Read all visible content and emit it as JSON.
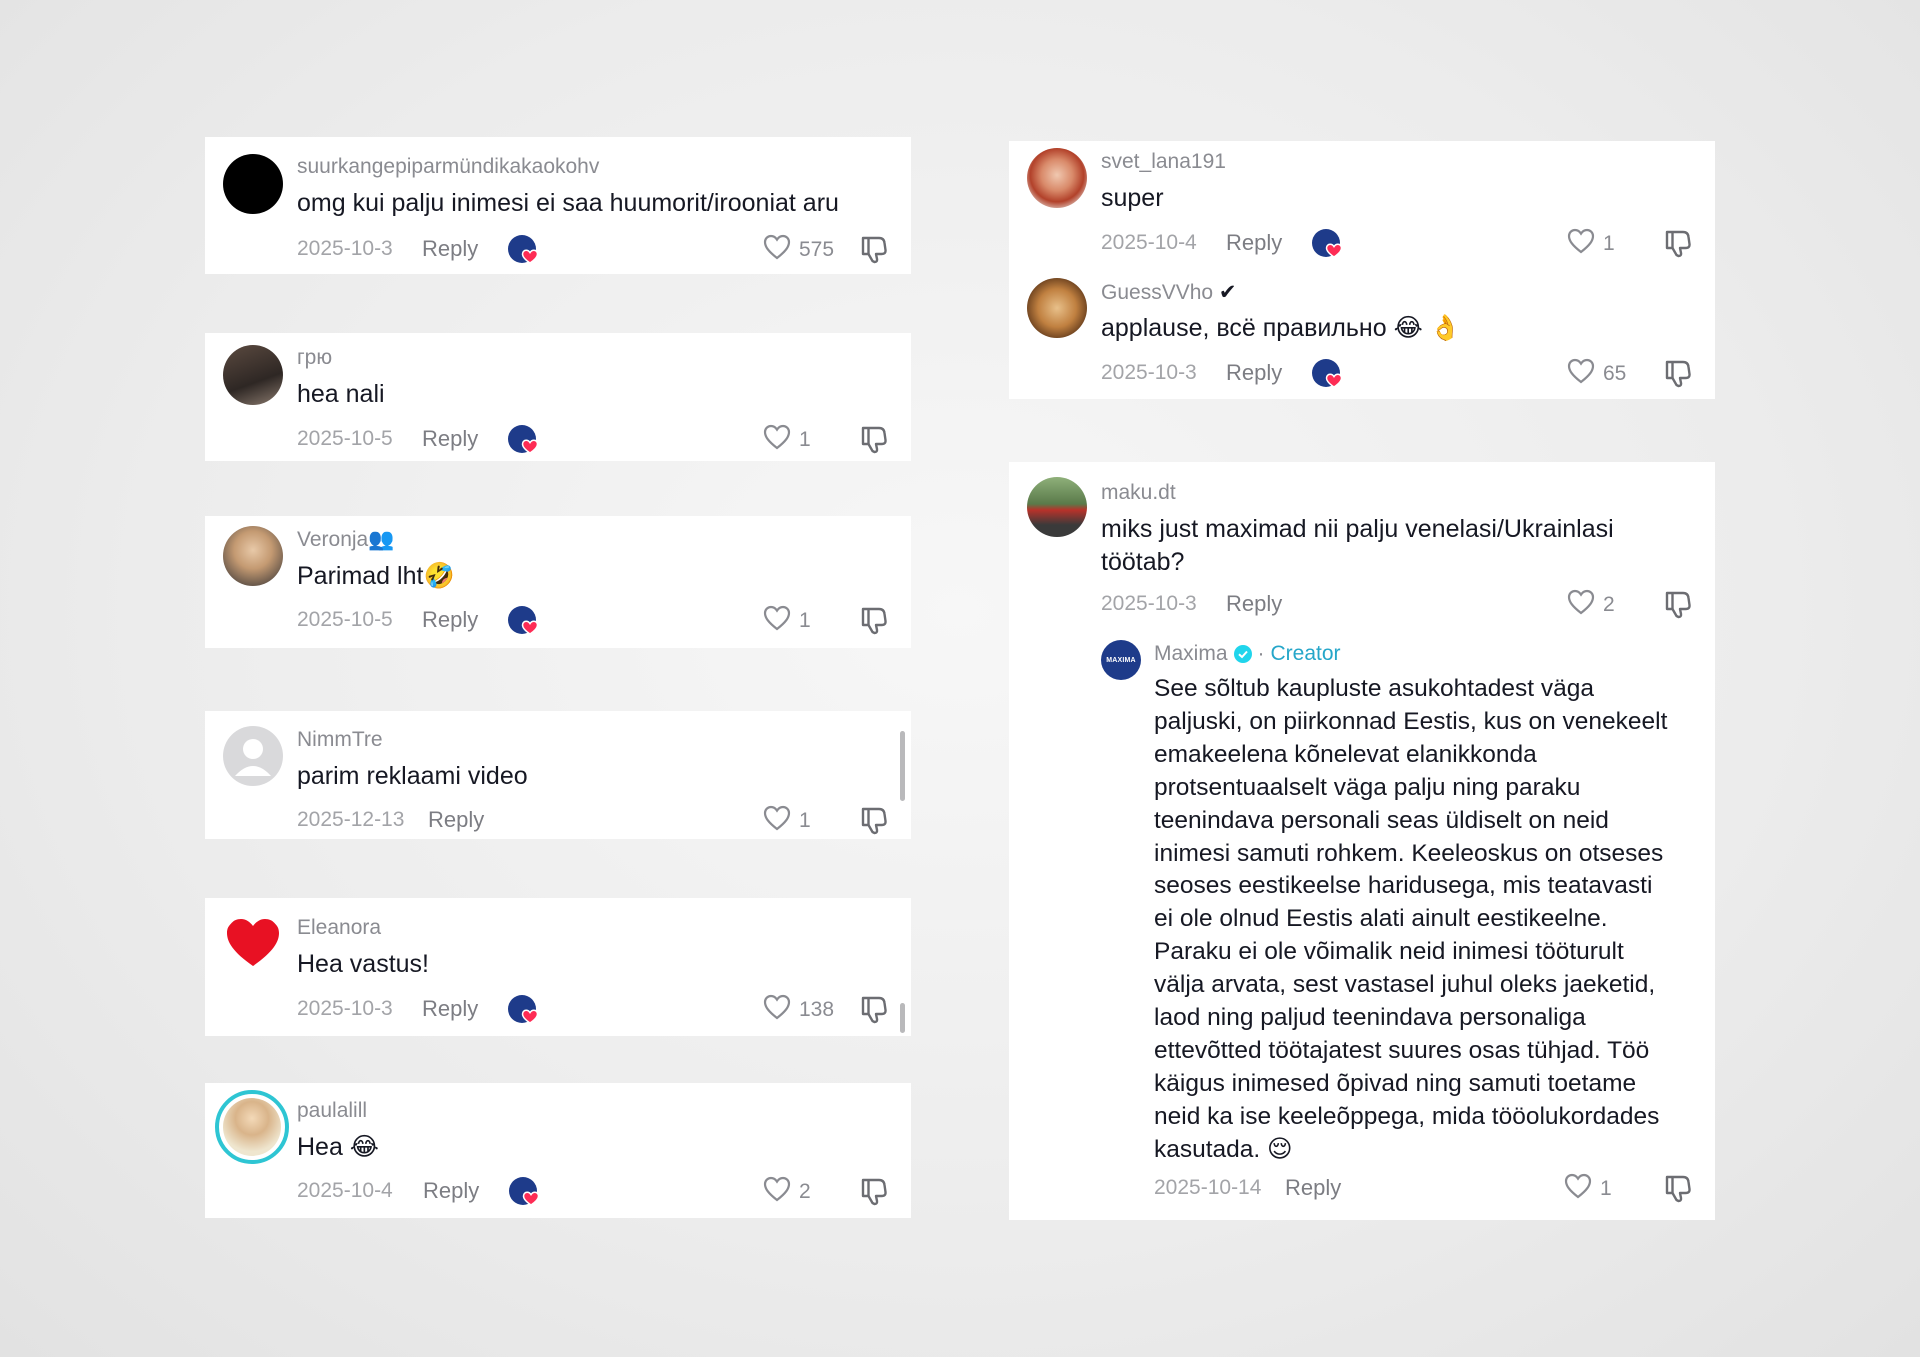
{
  "left_comments": [
    {
      "username": "suurkangepiparmündikakaokohv",
      "text": "omg kui palju inimesi ei saa huumorit/irooniat aru",
      "date": "2025-10-3",
      "reply": "Reply",
      "likes": "575",
      "avatar_icon": "black-circle-avatar-icon",
      "creator_liked": true
    },
    {
      "username": "грю",
      "text": "hea nali",
      "date": "2025-10-5",
      "reply": "Reply",
      "likes": "1",
      "avatar_icon": "person-photo-avatar-icon",
      "creator_liked": true
    },
    {
      "username": "Veronja",
      "username_emoji": "👥",
      "text": "Parimad lht🤣",
      "date": "2025-10-5",
      "reply": "Reply",
      "likes": "1",
      "avatar_icon": "woman-photo-avatar-icon",
      "creator_liked": true
    },
    {
      "username": "NimmTre",
      "text": "parim reklaami video",
      "date": "2025-12-13",
      "reply": "Reply",
      "likes": "1",
      "avatar_icon": "default-user-avatar-icon",
      "creator_liked": false
    },
    {
      "username": "Eleanora",
      "text": "Hea vastus!",
      "date": "2025-10-3",
      "reply": "Reply",
      "likes": "138",
      "avatar_icon": "red-heart-avatar-icon",
      "creator_liked": true
    },
    {
      "username": "paulalill",
      "text": "Hea 😂",
      "date": "2025-10-4",
      "reply": "Reply",
      "likes": "2",
      "avatar_icon": "woman-photo-avatar-icon",
      "creator_liked": true
    }
  ],
  "right_top_comments": [
    {
      "username": "svet_lana191",
      "text": "super",
      "date": "2025-10-4",
      "reply": "Reply",
      "likes": "1",
      "avatar_icon": "red-hair-photo-avatar-icon",
      "creator_liked": true
    },
    {
      "username": "GuessVVho",
      "username_suffix": "✔",
      "text": "applause, всё правильно 😂 👌",
      "date": "2025-10-3",
      "reply": "Reply",
      "likes": "65",
      "avatar_icon": "cartoon-character-avatar-icon",
      "creator_liked": true
    }
  ],
  "right_thread": {
    "comment": {
      "username": "maku.dt",
      "text": "miks just maximad nii palju venelasi/Ukrainlasi töötab?",
      "date": "2025-10-3",
      "reply": "Reply",
      "likes": "2",
      "avatar_icon": "motorcycle-photo-avatar-icon",
      "creator_liked": false
    },
    "creator_reply": {
      "username": "Maxima",
      "separator": "·",
      "creator_label": "Creator",
      "avatar_text": "MAXIMA",
      "lines": [
        "See sõltub kaupluste asukohtadest väga",
        "paljuski, on piirkonnad Eestis, kus on venekeelt",
        "emakeelena kõnelevat elanikkonda",
        "protsentuaalselt väga palju ning paraku",
        "teenindava personali seas üldiselt on neid",
        "inimesi samuti rohkem. Keeleoskus on otseses",
        "seoses eestikeelse haridusega, mis teatavasti",
        "ei ole olnud Eestis alati ainult eestikeelne.",
        "Paraku ei ole võimalik neid inimesi tööturult",
        "välja arvata, sest vastasel juhul oleks jaeketid,",
        "laod ning paljud teenindava personaliga",
        "ettevõtted töötajatest suures osas tühjad. Töö",
        "käigus inimesed õpivad ning samuti toetame",
        "neid ka ise keeleõppega, mida tööolukordades",
        "kasutada. 😌"
      ],
      "date": "2025-10-14",
      "reply": "Reply",
      "likes": "1"
    }
  },
  "colors": {
    "creator_badge_blue": "#1e3b8a",
    "creator_heart": "#fe2c55",
    "verified": "#20d5ec",
    "creator_label": "#25a6c9"
  }
}
